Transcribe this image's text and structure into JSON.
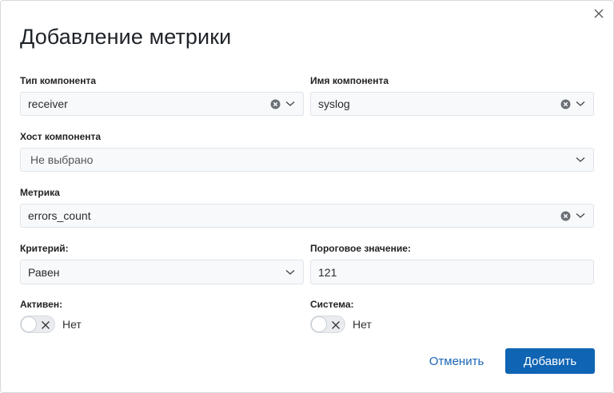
{
  "dialog": {
    "title": "Добавление метрики",
    "close_icon": "close-icon"
  },
  "fields": {
    "component_type": {
      "label": "Тип компонента",
      "value": "receiver"
    },
    "component_name": {
      "label": "Имя компонента",
      "value": "syslog"
    },
    "component_host": {
      "label": "Хост компонента",
      "placeholder": "Не выбрано"
    },
    "metric": {
      "label": "Метрика",
      "value": "errors_count"
    },
    "criterion": {
      "label": "Критерий:",
      "value": "Равен"
    },
    "threshold": {
      "label": "Пороговое значение:",
      "value": "121"
    },
    "active": {
      "label": "Активен:",
      "state": "Нет"
    },
    "system": {
      "label": "Система:",
      "state": "Нет"
    }
  },
  "buttons": {
    "cancel": "Отменить",
    "add": "Добавить"
  },
  "colors": {
    "primary": "#0f64b3",
    "link": "#1a66b5",
    "field_bg": "#f7f9fb",
    "field_border": "#dfe3e8"
  }
}
